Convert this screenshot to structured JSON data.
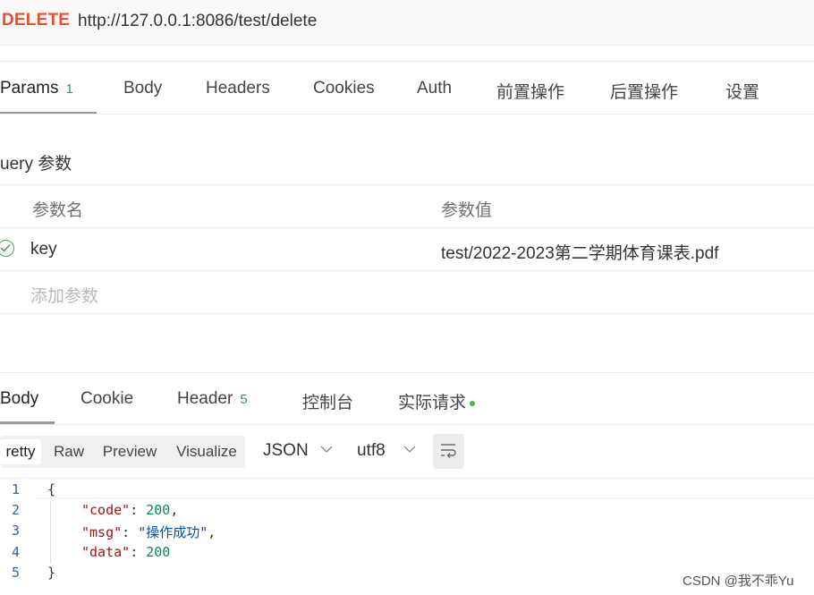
{
  "request": {
    "method": "DELETE",
    "url": "http://127.0.0.1:8086/test/delete"
  },
  "request_tabs": [
    {
      "label": "Params",
      "count": "1",
      "active": true
    },
    {
      "label": "Body"
    },
    {
      "label": "Headers"
    },
    {
      "label": "Cookies"
    },
    {
      "label": "Auth"
    },
    {
      "label": "前置操作"
    },
    {
      "label": "后置操作"
    },
    {
      "label": "设置"
    }
  ],
  "query": {
    "section_title": "uery 参数",
    "col_name": "参数名",
    "col_value": "参数值",
    "rows": [
      {
        "key": "key",
        "value": "test/2022-2023第二学期体育课表.pdf",
        "enabled": true
      }
    ],
    "add_placeholder": "添加参数"
  },
  "response_tabs": [
    {
      "label": "Body",
      "active": true
    },
    {
      "label": "Cookie"
    },
    {
      "label": "Header",
      "count": "5"
    },
    {
      "label": "控制台"
    },
    {
      "label": "实际请求"
    }
  ],
  "view": {
    "modes": [
      "retty",
      "Raw",
      "Preview",
      "Visualize"
    ],
    "format": "JSON",
    "encoding": "utf8"
  },
  "code": {
    "line_numbers": [
      "1",
      "2",
      "3",
      "4",
      "5"
    ],
    "open_brace": "{",
    "close_brace": "}",
    "entries": [
      {
        "key": "\"code\"",
        "value": "200",
        "sep": ": ",
        "trail": ","
      },
      {
        "key": "\"msg\"",
        "value": "\"操作成功\"",
        "sep": ": ",
        "trail": ","
      },
      {
        "key": "\"data\"",
        "value": "200",
        "sep": ": ",
        "trail": ""
      }
    ]
  },
  "watermark": "CSDN @我不乖Yu",
  "colors": {
    "method": "#e8502e",
    "count": "#3c9a4c",
    "accent_dot": "#49b35c"
  }
}
